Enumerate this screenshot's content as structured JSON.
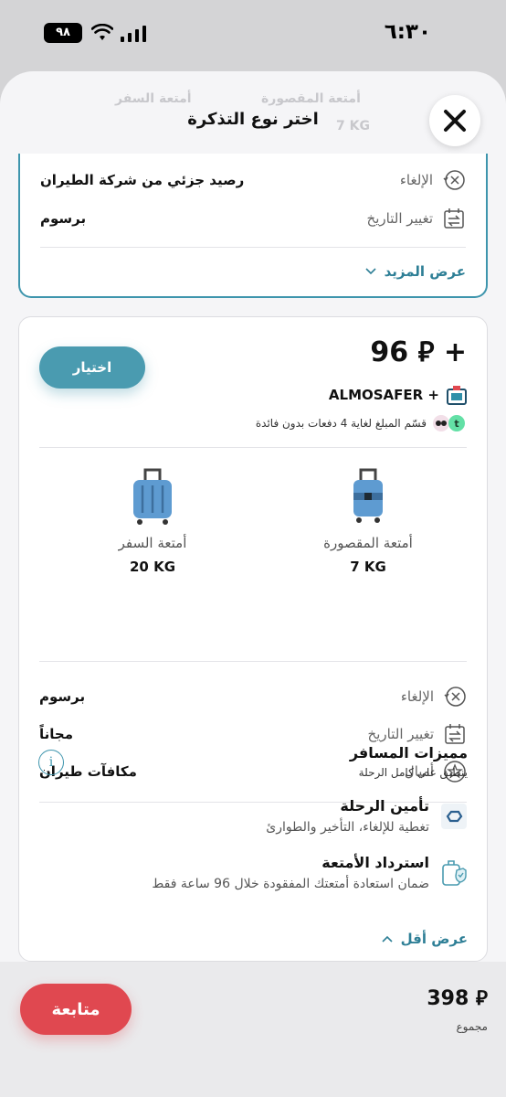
{
  "status_bar": {
    "time": "٦:٣٠",
    "battery": "٩٨"
  },
  "sheet": {
    "title": "اختر نوع التذكرة",
    "ghost": {
      "carry_on": "أمتعة المقصورة",
      "checked": "أمتعة السفر",
      "carry_on_weight": "7 KG"
    }
  },
  "card1": {
    "rows": [
      {
        "icon": "cancel-icon",
        "name": "الإلغاء",
        "value": "رصيد جزئي من شركة الطيران"
      },
      {
        "icon": "calendar-change-icon",
        "name": "تغيير التاريخ",
        "value": "برسوم"
      }
    ],
    "show_more": "عرض المزيد"
  },
  "card2": {
    "price": "96 ⃁ +",
    "choose_label": "اختيار",
    "provider_name": "ALMOSAFER +",
    "installment_text": "قسّم المبلغ لغاية 4 دفعات بدون فائدة",
    "bags": [
      {
        "label": "أمتعة المقصورة",
        "weight": "7 KG"
      },
      {
        "label": "أمتعة السفر",
        "weight": "20 KG"
      }
    ],
    "rows": [
      {
        "icon": "cancel-icon",
        "name": "الإلغاء",
        "value": "برسوم"
      },
      {
        "icon": "calendar-change-icon",
        "name": "تغيير التاريخ",
        "value": "مجاناً"
      },
      {
        "icon": "star-icon",
        "name": "أميال",
        "value": "مكافآت طيران"
      }
    ],
    "perks_title": "مميزات المسافر",
    "perks_subtitle": "ينطبق على كامل الرحلة",
    "perks": [
      {
        "title": "تأمين الرحلة",
        "desc": "تغطية للإلغاء، التأخير والطوارئ"
      },
      {
        "title": "استرداد الأمتعة",
        "desc": "ضمان استعادة أمتعتك المفقودة خلال 96 ساعة فقط"
      }
    ],
    "show_less": "عرض أقل"
  },
  "bottom": {
    "total_price": "398 ⃁",
    "total_label": "مجموع",
    "continue_label": "متابعة"
  },
  "colors": {
    "accent": "#3e95ad",
    "button_teal": "#4a9bb0",
    "continue_red": "#e04850"
  }
}
